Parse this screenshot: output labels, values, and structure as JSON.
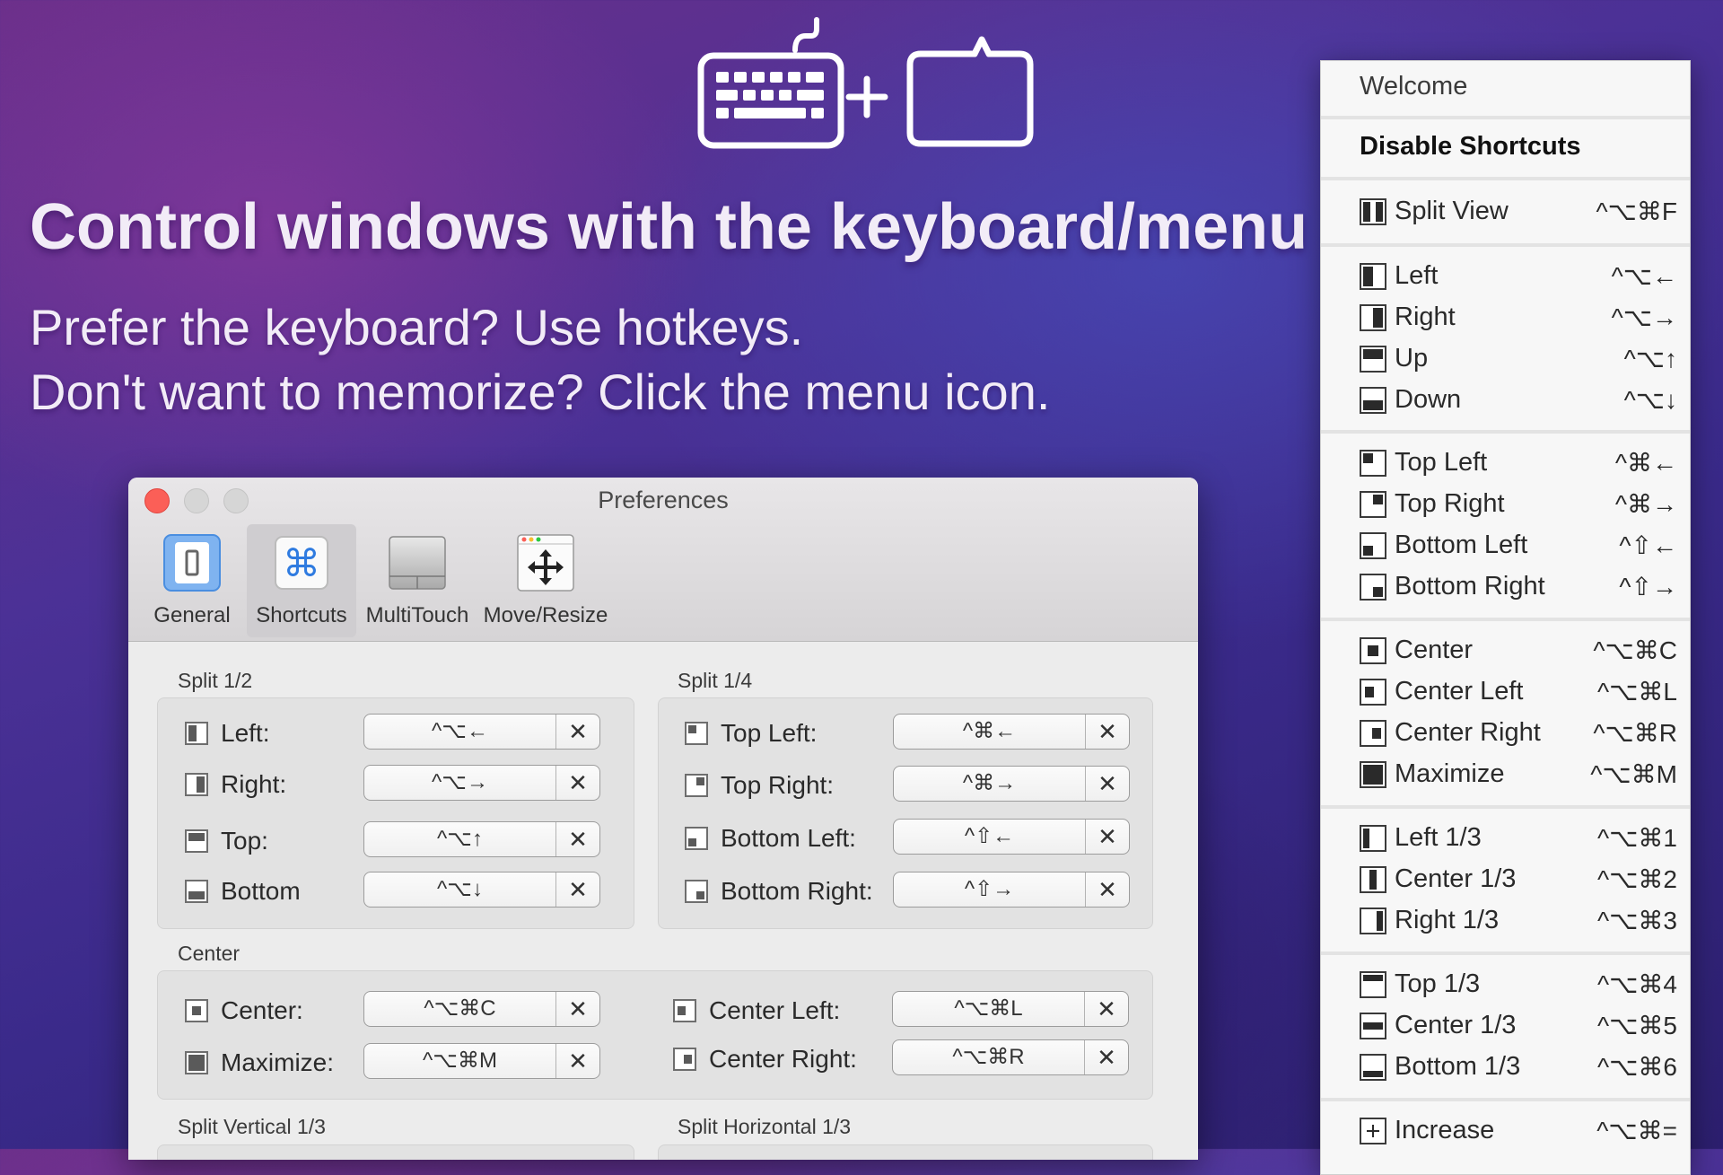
{
  "hero": {
    "headline": "Control windows with the keyboard/menu",
    "line1": "Prefer the keyboard? Use hotkeys.",
    "line2": "Don't want to memorize? Click the menu icon."
  },
  "prefs": {
    "title": "Preferences",
    "tabs": [
      {
        "label": "General",
        "icon": "switch-icon",
        "active": false
      },
      {
        "label": "Shortcuts",
        "icon": "command-icon",
        "active": true
      },
      {
        "label": "MultiTouch",
        "icon": "trackpad-icon",
        "active": false
      },
      {
        "label": "Move/Resize",
        "icon": "move-arrows-icon",
        "active": false
      }
    ],
    "sections": {
      "split_half": {
        "title": "Split 1/2",
        "rows": [
          {
            "label": "Left:",
            "keys": "^⌥←",
            "clear": "✕"
          },
          {
            "label": "Right:",
            "keys": "^⌥→",
            "clear": "✕"
          },
          {
            "label": "Top:",
            "keys": "^⌥↑",
            "clear": "✕"
          },
          {
            "label": "Bottom",
            "keys": "^⌥↓",
            "clear": "✕"
          }
        ]
      },
      "split_quarter": {
        "title": "Split 1/4",
        "rows": [
          {
            "label": "Top Left:",
            "keys": "^⌘←",
            "clear": "✕"
          },
          {
            "label": "Top Right:",
            "keys": "^⌘→",
            "clear": "✕"
          },
          {
            "label": "Bottom Left:",
            "keys": "^⇧←",
            "clear": "✕"
          },
          {
            "label": "Bottom Right:",
            "keys": "^⇧→",
            "clear": "✕"
          }
        ]
      },
      "center": {
        "title": "Center",
        "rows": [
          {
            "label": "Center:",
            "keys": "^⌥⌘C",
            "clear": "✕"
          },
          {
            "label": "Maximize:",
            "keys": "^⌥⌘M",
            "clear": "✕"
          },
          {
            "label": "Center Left:",
            "keys": "^⌥⌘L",
            "clear": "✕"
          },
          {
            "label": "Center Right:",
            "keys": "^⌥⌘R",
            "clear": "✕"
          }
        ]
      },
      "split_vertical_third": {
        "title": "Split Vertical 1/3"
      },
      "split_horizontal_third": {
        "title": "Split Horizontal 1/3"
      }
    }
  },
  "menu": {
    "welcome": "Welcome",
    "disable": "Disable Shortcuts",
    "items": [
      {
        "label": "Split View",
        "keys": "^⌥⌘F",
        "icon": "split-view-icon"
      },
      {
        "label": "Left",
        "keys": "^⌥←",
        "icon": "left-half-icon"
      },
      {
        "label": "Right",
        "keys": "^⌥→",
        "icon": "right-half-icon"
      },
      {
        "label": "Up",
        "keys": "^⌥↑",
        "icon": "top-half-icon"
      },
      {
        "label": "Down",
        "keys": "^⌥↓",
        "icon": "bottom-half-icon"
      },
      {
        "label": "Top Left",
        "keys": "^⌘←",
        "icon": "top-left-icon"
      },
      {
        "label": "Top Right",
        "keys": "^⌘→",
        "icon": "top-right-icon"
      },
      {
        "label": "Bottom Left",
        "keys": "^⇧←",
        "icon": "bottom-left-icon"
      },
      {
        "label": "Bottom Right",
        "keys": "^⇧→",
        "icon": "bottom-right-icon"
      },
      {
        "label": "Center",
        "keys": "^⌥⌘C",
        "icon": "center-icon"
      },
      {
        "label": "Center Left",
        "keys": "^⌥⌘L",
        "icon": "center-left-icon"
      },
      {
        "label": "Center Right",
        "keys": "^⌥⌘R",
        "icon": "center-right-icon"
      },
      {
        "label": "Maximize",
        "keys": "^⌥⌘M",
        "icon": "maximize-icon"
      },
      {
        "label": "Left 1/3",
        "keys": "^⌥⌘1",
        "icon": "left-third-icon"
      },
      {
        "label": "Center 1/3",
        "keys": "^⌥⌘2",
        "icon": "center-third-icon"
      },
      {
        "label": "Right 1/3",
        "keys": "^⌥⌘3",
        "icon": "right-third-icon"
      },
      {
        "label": "Top 1/3",
        "keys": "^⌥⌘4",
        "icon": "top-third-icon"
      },
      {
        "label": "Center 1/3",
        "keys": "^⌥⌘5",
        "icon": "middle-third-icon"
      },
      {
        "label": "Bottom 1/3",
        "keys": "^⌥⌘6",
        "icon": "bottom-third-icon"
      },
      {
        "label": "Increase",
        "keys": "^⌥⌘=",
        "icon": "plus-icon"
      }
    ]
  },
  "colors": {
    "close_button": "#fb5f57",
    "active_tab_bg": "#cfcdd0",
    "menu_bg": "#f7f7f7"
  }
}
